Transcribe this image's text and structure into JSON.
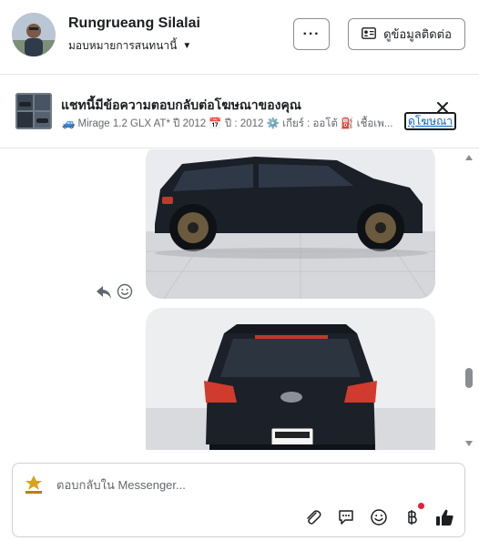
{
  "header": {
    "user_name": "Rungrueang Silalai",
    "assign_label": "มอบหมายการสนทนานี้",
    "more_label": "···",
    "contact_label": "ดูข้อมูลติดต่อ"
  },
  "ad_banner": {
    "title": "แชทนี้มีข้อความตอบกลับต่อโฆษณาของคุณ",
    "subtitle": "🚙 Mirage 1.2 GLX AT* ปี 2012 📅 ปี : 2012 ⚙️ เกียร์ : ออโต้ ⛽ เชื้อเพ...",
    "link_label": "ดูโฆษณา"
  },
  "composer": {
    "placeholder": "ตอบกลับใน Messenger..."
  },
  "colors": {
    "accent": "#0064d1",
    "badge": "#e41e3f",
    "text_primary": "#1c1e21",
    "text_secondary": "#65676b"
  },
  "icons": [
    "more-icon",
    "contact-card-icon",
    "caret-down-icon",
    "close-icon",
    "reply-icon",
    "emoji-icon",
    "attachment-icon",
    "saved-reply-icon",
    "baht-icon",
    "like-icon"
  ]
}
